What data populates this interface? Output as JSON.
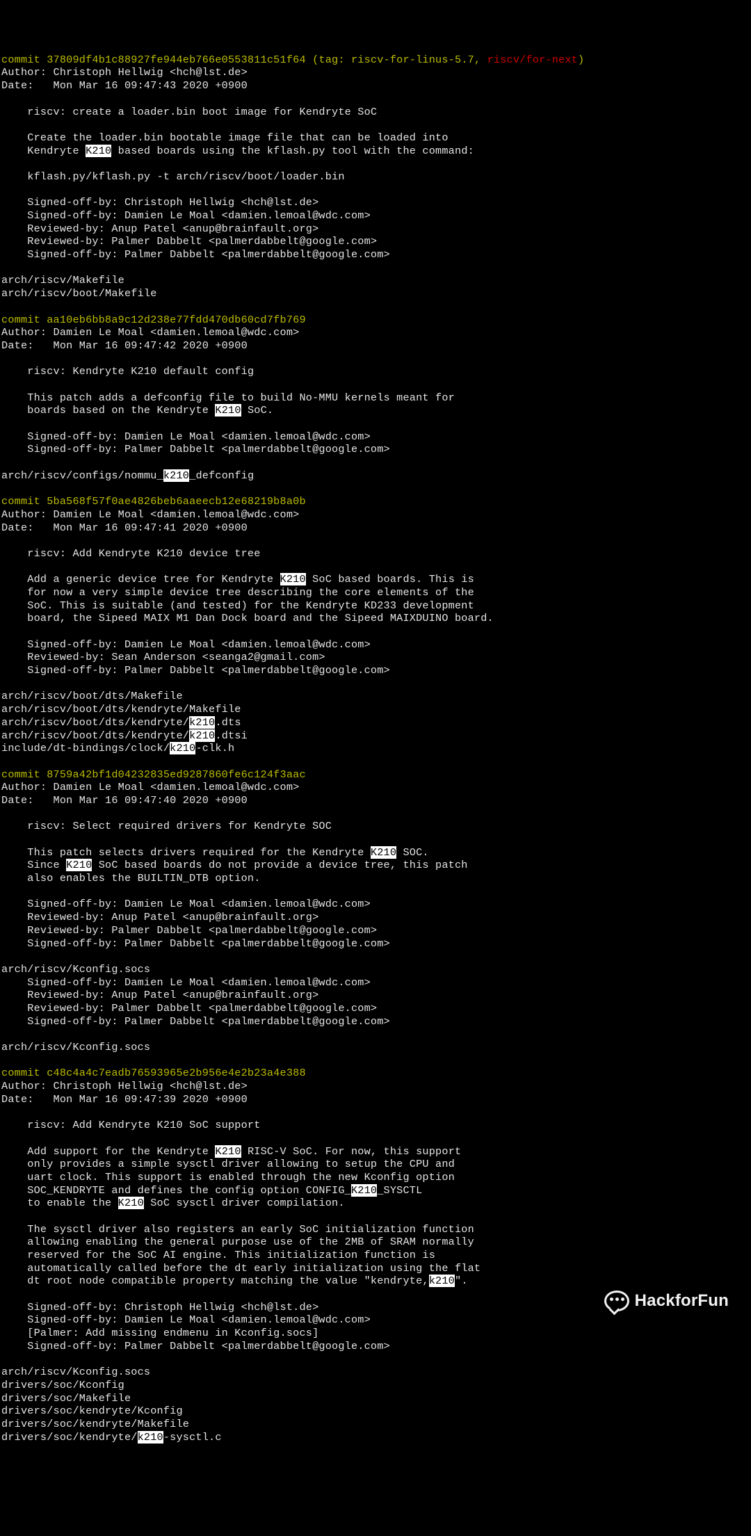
{
  "highlight_term": "k210",
  "watermark": "HackforFun",
  "commits": [
    {
      "hash": "37809df4b1c88927fe944eb766e0553811c51f64",
      "tag_label": "tag: riscv-for-linus-5.7",
      "tag_extra": "riscv/for-next",
      "author": "Christoph Hellwig <hch@lst.de>",
      "date": "Mon Mar 16 09:47:43 2020 +0900",
      "subject": "riscv: create a loader.bin boot image for Kendryte SoC",
      "body": [
        "Create the loader.bin bootable image file that can be loaded into",
        "Kendryte K210 based boards using the kflash.py tool with the command:",
        "",
        "kflash.py/kflash.py -t arch/riscv/boot/loader.bin",
        "",
        "Signed-off-by: Christoph Hellwig <hch@lst.de>",
        "Signed-off-by: Damien Le Moal <damien.lemoal@wdc.com>",
        "Reviewed-by: Anup Patel <anup@brainfault.org>",
        "Reviewed-by: Palmer Dabbelt <palmerdabbelt@google.com>",
        "Signed-off-by: Palmer Dabbelt <palmerdabbelt@google.com>"
      ],
      "files": [
        "arch/riscv/Makefile",
        "arch/riscv/boot/Makefile"
      ]
    },
    {
      "hash": "aa10eb6bb8a9c12d238e77fdd470db60cd7fb769",
      "author": "Damien Le Moal <damien.lemoal@wdc.com>",
      "date": "Mon Mar 16 09:47:42 2020 +0900",
      "subject": "riscv: Kendryte K210 default config",
      "body": [
        "This patch adds a defconfig file to build No-MMU kernels meant for",
        "boards based on the Kendryte K210 SoC.",
        "",
        "Signed-off-by: Damien Le Moal <damien.lemoal@wdc.com>",
        "Signed-off-by: Palmer Dabbelt <palmerdabbelt@google.com>"
      ],
      "files": [
        "arch/riscv/configs/nommu_k210_defconfig"
      ]
    },
    {
      "hash": "5ba568f57f0ae4826beb6aaeecb12e68219b8a0b",
      "author": "Damien Le Moal <damien.lemoal@wdc.com>",
      "date": "Mon Mar 16 09:47:41 2020 +0900",
      "subject": "riscv: Add Kendryte K210 device tree",
      "body": [
        "Add a generic device tree for Kendryte K210 SoC based boards. This is",
        "for now a very simple device tree describing the core elements of the",
        "SoC. This is suitable (and tested) for the Kendryte KD233 development",
        "board, the Sipeed MAIX M1 Dan Dock board and the Sipeed MAIXDUINO board.",
        "",
        "Signed-off-by: Damien Le Moal <damien.lemoal@wdc.com>",
        "Reviewed-by: Sean Anderson <seanga2@gmail.com>",
        "Signed-off-by: Palmer Dabbelt <palmerdabbelt@google.com>"
      ],
      "files": [
        "arch/riscv/boot/dts/Makefile",
        "arch/riscv/boot/dts/kendryte/Makefile",
        "arch/riscv/boot/dts/kendryte/k210.dts",
        "arch/riscv/boot/dts/kendryte/k210.dtsi",
        "include/dt-bindings/clock/k210-clk.h"
      ]
    },
    {
      "hash": "8759a42bf1d04232835ed9287860fe6c124f3aac",
      "author": "Damien Le Moal <damien.lemoal@wdc.com>",
      "date": "Mon Mar 16 09:47:40 2020 +0900",
      "subject": "riscv: Select required drivers for Kendryte SOC",
      "body": [
        "This patch selects drivers required for the Kendryte K210 SOC.",
        "Since K210 SoC based boards do not provide a device tree, this patch",
        "also enables the BUILTIN_DTB option.",
        "",
        "Signed-off-by: Damien Le Moal <damien.lemoal@wdc.com>",
        "Reviewed-by: Anup Patel <anup@brainfault.org>",
        "Reviewed-by: Palmer Dabbelt <palmerdabbelt@google.com>",
        "Signed-off-by: Palmer Dabbelt <palmerdabbelt@google.com>"
      ],
      "files": [
        "arch/riscv/Kconfig.socs"
      ],
      "trailing_body": [
        "Signed-off-by: Damien Le Moal <damien.lemoal@wdc.com>",
        "Reviewed-by: Anup Patel <anup@brainfault.org>",
        "Reviewed-by: Palmer Dabbelt <palmerdabbelt@google.com>",
        "Signed-off-by: Palmer Dabbelt <palmerdabbelt@google.com>"
      ],
      "trailing_files": [
        "arch/riscv/Kconfig.socs"
      ]
    },
    {
      "hash": "c48c4a4c7eadb76593965e2b956e4e2b23a4e388",
      "author": "Christoph Hellwig <hch@lst.de>",
      "date": "Mon Mar 16 09:47:39 2020 +0900",
      "subject": "riscv: Add Kendryte K210 SoC support",
      "body": [
        "Add support for the Kendryte K210 RISC-V SoC. For now, this support",
        "only provides a simple sysctl driver allowing to setup the CPU and",
        "uart clock. This support is enabled through the new Kconfig option",
        "SOC_KENDRYTE and defines the config option CONFIG_K210_SYSCTL",
        "to enable the K210 SoC sysctl driver compilation.",
        "",
        "The sysctl driver also registers an early SoC initialization function",
        "allowing enabling the general purpose use of the 2MB of SRAM normally",
        "reserved for the SoC AI engine. This initialization function is",
        "automatically called before the dt early initialization using the flat",
        "dt root node compatible property matching the value \"kendryte,k210\".",
        "",
        "Signed-off-by: Christoph Hellwig <hch@lst.de>",
        "Signed-off-by: Damien Le Moal <damien.lemoal@wdc.com>",
        "[Palmer: Add missing endmenu in Kconfig.socs]",
        "Signed-off-by: Palmer Dabbelt <palmerdabbelt@google.com>"
      ],
      "files": [
        "arch/riscv/Kconfig.socs",
        "drivers/soc/Kconfig",
        "drivers/soc/Makefile",
        "drivers/soc/kendryte/Kconfig",
        "drivers/soc/kendryte/Makefile",
        "drivers/soc/kendryte/k210-sysctl.c"
      ]
    }
  ]
}
